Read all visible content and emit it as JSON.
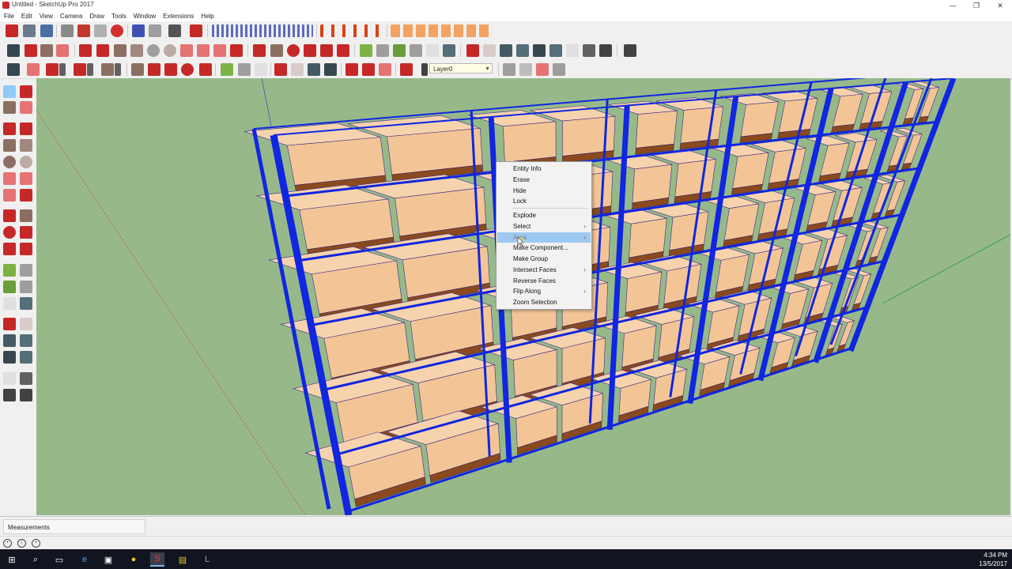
{
  "window": {
    "title": "Untitled - SketchUp Pro 2017",
    "minimize_glyph": "—",
    "maximize_glyph": "❐",
    "close_glyph": "✕"
  },
  "menubar": {
    "items": [
      "File",
      "Edit",
      "View",
      "Camera",
      "Draw",
      "Tools",
      "Window",
      "Extensions",
      "Help"
    ]
  },
  "layer": {
    "value": "Layer0",
    "arrow": "▼"
  },
  "context_menu": {
    "items": [
      {
        "label": "Entity Info",
        "submenu": ""
      },
      {
        "label": "Erase",
        "submenu": ""
      },
      {
        "label": "Hide",
        "submenu": ""
      },
      {
        "label": "Lock",
        "submenu": ""
      },
      {
        "label": "Explode",
        "submenu": ""
      },
      {
        "label": "Select",
        "submenu": "›"
      },
      {
        "label": "Area",
        "submenu": "›"
      },
      {
        "label": "Make Component...",
        "submenu": ""
      },
      {
        "label": "Make Group",
        "submenu": ""
      },
      {
        "label": "Intersect Faces",
        "submenu": "›"
      },
      {
        "label": "Reverse Faces",
        "submenu": ""
      },
      {
        "label": "Flip Along",
        "submenu": "›"
      },
      {
        "label": "Zoom Selection",
        "submenu": ""
      }
    ],
    "active_item": "Area"
  },
  "measurements": {
    "label": "Measurements"
  },
  "statusbar": {
    "icons": [
      "geo-location-icon",
      "info-icon",
      "user-account-icon"
    ],
    "icon_glyphs": [
      "•",
      "i",
      "•"
    ]
  },
  "taskbar": {
    "time": "4:34 PM",
    "date": "13/5/2017",
    "apps": [
      "start-icon",
      "search-icon",
      "task-view-icon",
      "edge-icon",
      "store-icon",
      "chrome-icon",
      "sketchup-icon",
      "file-explorer-icon",
      "layout-icon"
    ],
    "app_glyphs": [
      "⊞",
      "⌕",
      "▭",
      "e",
      "▣",
      "●",
      "S",
      "▤",
      "L"
    ]
  },
  "colors": {
    "sky": "#97b98a",
    "rack": "#1026e0",
    "box": "#f3c596",
    "pallet": "#8a4a1e",
    "highlight": "#9ec9f2"
  }
}
